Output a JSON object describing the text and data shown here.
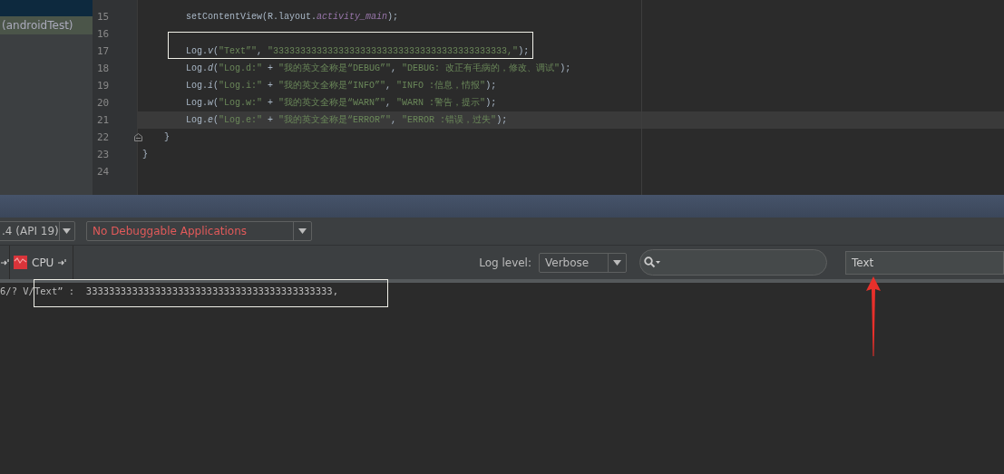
{
  "sidebar": {
    "items": [
      {
        "label": "(androidTest)",
        "selected": true
      }
    ]
  },
  "editor": {
    "lines": [
      {
        "number": "15",
        "kind": "statement",
        "current": false,
        "code": [
          {
            "kind": "plain",
            "text": "setContentView(R.layout."
          },
          {
            "kind": "static",
            "text": "activity_main"
          },
          {
            "kind": "plain",
            "text": ");"
          }
        ]
      },
      {
        "number": "16",
        "current": false
      },
      {
        "number": "17",
        "kind": "statement",
        "current": false,
        "code": [
          {
            "kind": "plain",
            "text": "Log."
          },
          {
            "kind": "method",
            "text": "v"
          },
          {
            "kind": "plain",
            "text": "("
          },
          {
            "kind": "string",
            "text": "\"Text”\""
          },
          {
            "kind": "plain",
            "text": ", "
          },
          {
            "kind": "string",
            "text": "\"3333333333333333333333333333333333333333333,\""
          },
          {
            "kind": "plain",
            "text": ");"
          }
        ]
      },
      {
        "number": "18",
        "kind": "statement",
        "current": false,
        "code": [
          {
            "kind": "plain",
            "text": "Log."
          },
          {
            "kind": "method",
            "text": "d"
          },
          {
            "kind": "plain",
            "text": "("
          },
          {
            "kind": "string",
            "text": "\"Log.d:\""
          },
          {
            "kind": "plain",
            "text": " + "
          },
          {
            "kind": "string",
            "text": "\"我的英文全称是“DEBUG”\""
          },
          {
            "kind": "plain",
            "text": ", "
          },
          {
            "kind": "string",
            "text": "\"DEBUG: 改正有毛病的，修改、调试\""
          },
          {
            "kind": "plain",
            "text": ");"
          }
        ]
      },
      {
        "number": "19",
        "kind": "statement",
        "current": false,
        "code": [
          {
            "kind": "plain",
            "text": "Log."
          },
          {
            "kind": "method",
            "text": "i"
          },
          {
            "kind": "plain",
            "text": "("
          },
          {
            "kind": "string",
            "text": "\"Log.i:\""
          },
          {
            "kind": "plain",
            "text": " + "
          },
          {
            "kind": "string",
            "text": "\"我的英文全称是“INFO”\""
          },
          {
            "kind": "plain",
            "text": ", "
          },
          {
            "kind": "string",
            "text": "\"INFO :信息，情报\""
          },
          {
            "kind": "plain",
            "text": ");"
          }
        ]
      },
      {
        "number": "20",
        "kind": "statement",
        "current": false,
        "code": [
          {
            "kind": "plain",
            "text": "Log."
          },
          {
            "kind": "method",
            "text": "w"
          },
          {
            "kind": "plain",
            "text": "("
          },
          {
            "kind": "string",
            "text": "\"Log.w:\""
          },
          {
            "kind": "plain",
            "text": " + "
          },
          {
            "kind": "string",
            "text": "\"我的英文全称是“WARN”\""
          },
          {
            "kind": "plain",
            "text": ", "
          },
          {
            "kind": "string",
            "text": "\"WARN :警告，提示\""
          },
          {
            "kind": "plain",
            "text": ");"
          }
        ]
      },
      {
        "number": "21",
        "kind": "statement",
        "current": true,
        "code": [
          {
            "kind": "plain",
            "text": "Log."
          },
          {
            "kind": "method",
            "text": "e"
          },
          {
            "kind": "plain",
            "text": "("
          },
          {
            "kind": "string",
            "text": "\"Log.e:\""
          },
          {
            "kind": "plain",
            "text": " + "
          },
          {
            "kind": "string",
            "text": "\"我的英文全称是“ERROR”\""
          },
          {
            "kind": "plain",
            "text": ", "
          },
          {
            "kind": "string",
            "text": "\"ERROR :错误，过失\""
          },
          {
            "kind": "plain",
            "text": ");"
          }
        ]
      },
      {
        "number": "22",
        "kind": "method_end",
        "current": false,
        "folding": true,
        "code": [
          {
            "kind": "plain",
            "text": "}"
          }
        ]
      },
      {
        "number": "23",
        "kind": "class_end",
        "current": false,
        "code": [
          {
            "kind": "plain",
            "text": "}"
          }
        ]
      },
      {
        "number": "24",
        "current": false
      }
    ]
  },
  "toolbar": {
    "device": ".4 (API 19)",
    "application": "No Debuggable Applications",
    "monitor_button": "CPU",
    "log_level_label": "Log level:",
    "log_level": "Verbose",
    "filter": "Text"
  },
  "logcat": {
    "lines": [
      "6/? V/Text” :  3333333333333333333333333333333333333333333,"
    ]
  }
}
